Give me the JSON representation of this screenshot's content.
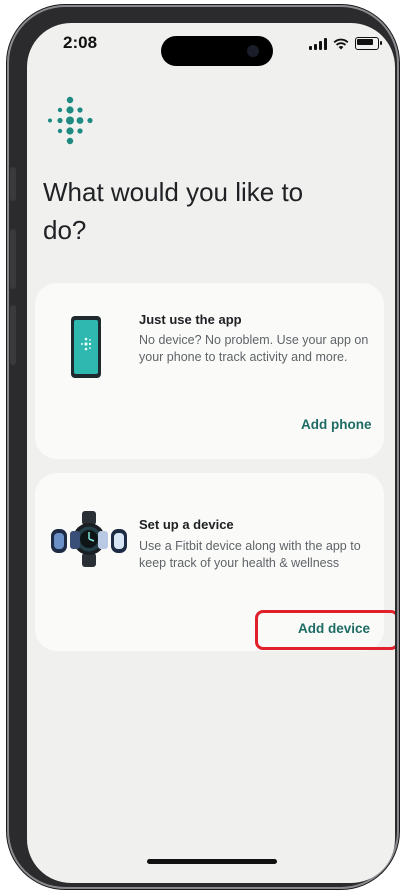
{
  "status_bar": {
    "time": "2:08"
  },
  "page": {
    "title": "What would you like to do?"
  },
  "options": [
    {
      "title": "Just use the app",
      "description": "No device? No problem. Use your app on your phone to track activity and more.",
      "action_label": "Add phone",
      "illustration": "phone-illustration-icon"
    },
    {
      "title": "Set up a device",
      "description": "Use a Fitbit device along with the app to keep track of your health & wellness",
      "action_label": "Add device",
      "illustration": "fitbit-devices-illustration-icon"
    }
  ],
  "colors": {
    "accent": "#1e6b63",
    "logo": "#1e8a82",
    "highlight": "#e0202a",
    "background": "#f0f1ef"
  }
}
